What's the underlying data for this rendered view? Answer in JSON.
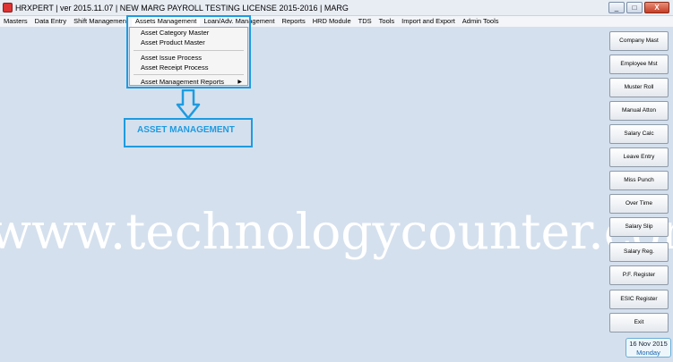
{
  "window": {
    "title": "HRXPERT | ver 2015.11.07 | NEW MARG PAYROLL TESTING LICENSE 2015-2016 | MARG",
    "minimize": "_",
    "maximize": "□",
    "close": "X"
  },
  "menubar": [
    {
      "label": "Masters"
    },
    {
      "label": "Data Entry"
    },
    {
      "label": "Shift Management"
    },
    {
      "label": "Assets Management"
    },
    {
      "label": "Loan/Adv. Management"
    },
    {
      "label": "Reports"
    },
    {
      "label": "HRD Module"
    },
    {
      "label": "TDS"
    },
    {
      "label": "Tools"
    },
    {
      "label": "Import and Export"
    },
    {
      "label": "Admin Tools"
    }
  ],
  "dropdown": {
    "items": [
      {
        "label": "Asset Category Master"
      },
      {
        "label": "Asset Product Master"
      },
      {
        "label": "Asset Issue Process"
      },
      {
        "label": "Asset Receipt Process"
      },
      {
        "label": "Asset Management Reports"
      }
    ],
    "submenu_arrow": "▶"
  },
  "annotation": {
    "label": "ASSET MANAGEMENT",
    "color": "#1e9be0"
  },
  "watermark": "www.technologycounter.com",
  "side_buttons": [
    {
      "label": "Company Mast"
    },
    {
      "label": "Employee Mst"
    },
    {
      "label": "Muster Roll"
    },
    {
      "label": "Manual Atton"
    },
    {
      "label": "Salary Calc"
    },
    {
      "label": "Leave Entry"
    },
    {
      "label": "Miss Punch"
    },
    {
      "label": "Over Time"
    },
    {
      "label": "Salary Slip"
    },
    {
      "label": "Salary Reg."
    },
    {
      "label": "P.F. Register"
    },
    {
      "label": "ESIC Register"
    },
    {
      "label": "Exit"
    }
  ],
  "date": {
    "date": "16 Nov 2015",
    "day": "Monday"
  }
}
